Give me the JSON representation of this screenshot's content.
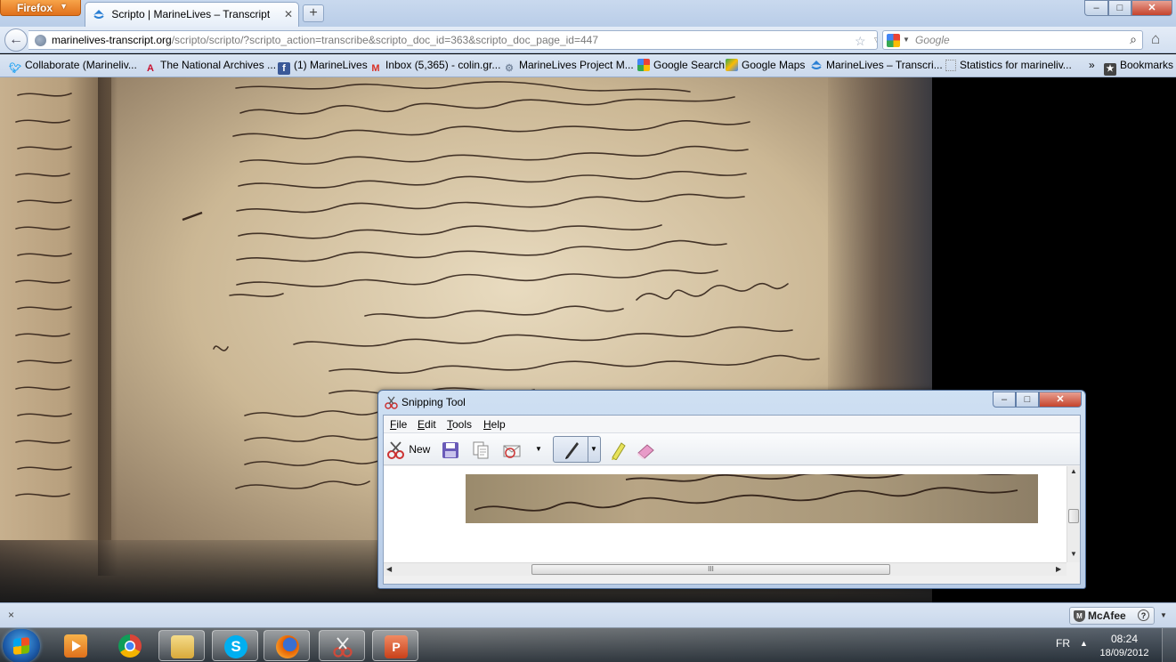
{
  "browser": {
    "app_button": "Firefox",
    "tab": {
      "title": "Scripto | MarineLives – Transcript"
    },
    "window_controls": {
      "minimize": "–",
      "maximize": "□",
      "close": "✕"
    },
    "url": {
      "host": "marinelives-transcript.org",
      "path": "/scripto/scripto/?scripto_action=transcribe&scripto_doc_id=363&scripto_doc_page_id=447"
    },
    "search": {
      "engine": "Google",
      "placeholder": "Google"
    },
    "bookmarks": [
      {
        "label": "Collaborate (Marineliv...",
        "icon": "twitter-bird-icon",
        "color": "#1da1f2"
      },
      {
        "label": "The National Archives ...",
        "icon": "national-archives-icon",
        "color": "#c8102e"
      },
      {
        "label": "(1) MarineLives",
        "icon": "facebook-icon",
        "color": "#3b5998"
      },
      {
        "label": "Inbox (5,365) - colin.gr...",
        "icon": "gmail-icon",
        "color": "#d93025"
      },
      {
        "label": "MarineLives Project M...",
        "icon": "gear-icon",
        "color": "#7a8aa0"
      },
      {
        "label": "Google Search",
        "icon": "google-icon",
        "color": "#4285f4"
      },
      {
        "label": "Google Maps",
        "icon": "google-maps-icon",
        "color": "#34a853"
      },
      {
        "label": "MarineLives – Transcri...",
        "icon": "scripto-icon",
        "color": "#2a7fd4"
      },
      {
        "label": "Statistics for marineliv...",
        "icon": "blank-page-icon",
        "color": "#999999"
      }
    ],
    "bookmarks_overflow": "»",
    "bookmarks_menu": "Bookmarks"
  },
  "snipping_tool": {
    "title": "Snipping Tool",
    "menu": [
      "File",
      "Edit",
      "Tools",
      "Help"
    ],
    "menu_access": [
      "F",
      "E",
      "T",
      "H"
    ],
    "new_label": "New",
    "controls": {
      "minimize": "–",
      "maximize": "□",
      "close": "✕"
    },
    "scroll_grip": "III"
  },
  "addon_bar": {
    "close": "×",
    "mcafee": "McAfee",
    "help": "?"
  },
  "taskbar": {
    "language": "FR",
    "time": "08:24",
    "date": "18/09/2012",
    "apps": [
      {
        "icon": "media-player-icon",
        "color": "#f08a1c"
      },
      {
        "icon": "chrome-icon",
        "color": "#db4437"
      },
      {
        "icon": "file-explorer-icon",
        "color": "#e9c46a"
      },
      {
        "icon": "skype-icon",
        "color": "#00aff0"
      },
      {
        "icon": "firefox-icon",
        "color": "#e66000"
      },
      {
        "icon": "snipping-tool-icon",
        "color": "#d04a3a"
      },
      {
        "icon": "powerpoint-icon",
        "color": "#d24726"
      }
    ]
  }
}
